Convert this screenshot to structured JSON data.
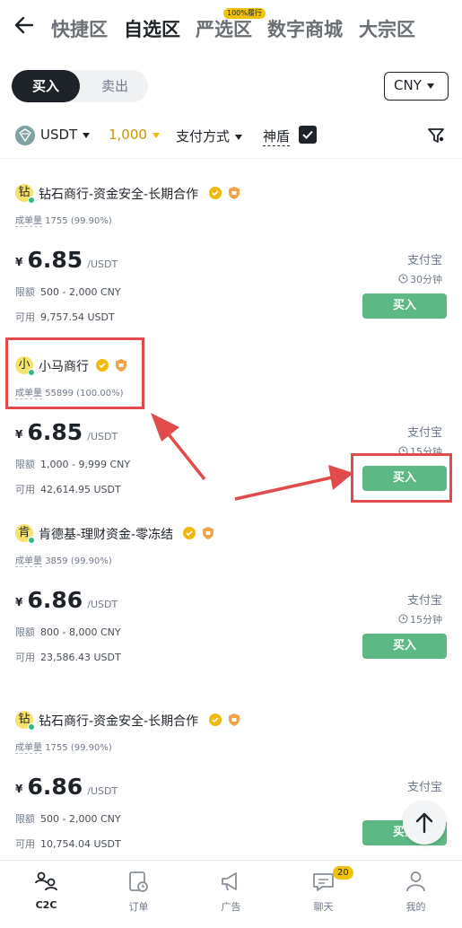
{
  "nav": {
    "tabs": [
      {
        "label": "快捷区"
      },
      {
        "label": "自选区"
      },
      {
        "label": "严选区"
      },
      {
        "label": "数字商城"
      },
      {
        "label": "大宗区"
      }
    ],
    "active_tab": "自选区",
    "badge": "100%履行"
  },
  "trade": {
    "buy_label": "买入",
    "sell_label": "卖出",
    "currency": "CNY"
  },
  "filters": {
    "asset": "USDT",
    "amount": "1,000",
    "payment": "支付方式",
    "shield": "神盾",
    "shield_checked": true
  },
  "listings": [
    {
      "avatar": "钻",
      "merchant": "钻石商行-资金安全-长期合作",
      "orders_label": "成单量",
      "orders": "1755 (99.90%)",
      "currency_symbol": "¥",
      "price": "6.85",
      "unit": "/USDT",
      "limit_label": "限额",
      "limit": "500 - 2,000 CNY",
      "available_label": "可用",
      "available": "9,757.54 USDT",
      "payment": "支付宝",
      "time": "30分钟",
      "action": "买入"
    },
    {
      "avatar": "小",
      "merchant": "小马商行",
      "orders_label": "成单量",
      "orders": "55899 (100.00%)",
      "currency_symbol": "¥",
      "price": "6.85",
      "unit": "/USDT",
      "limit_label": "限额",
      "limit": "1,000 - 9,999 CNY",
      "available_label": "可用",
      "available": "42,614.95 USDT",
      "payment": "支付宝",
      "time": "15分钟",
      "action": "买入"
    },
    {
      "avatar": "肯",
      "merchant": "肯德基-理财资金-零冻结",
      "orders_label": "成单量",
      "orders": "3859 (99.90%)",
      "currency_symbol": "¥",
      "price": "6.86",
      "unit": "/USDT",
      "limit_label": "限额",
      "limit": "800 - 8,000 CNY",
      "available_label": "可用",
      "available": "23,586.43 USDT",
      "payment": "支付宝",
      "time": "15分钟",
      "action": "买入"
    },
    {
      "avatar": "钻",
      "merchant": "钻石商行-资金安全-长期合作",
      "orders_label": "成单量",
      "orders": "1755 (99.90%)",
      "currency_symbol": "¥",
      "price": "6.86",
      "unit": "/USDT",
      "limit_label": "限额",
      "limit": "500 - 2,000 CNY",
      "available_label": "可用",
      "available": "10,754.04 USDT",
      "payment": "支付宝",
      "time": "",
      "action": "买入"
    }
  ],
  "bottom_nav": [
    {
      "label": "C2C",
      "icon": "c2c-icon"
    },
    {
      "label": "订单",
      "icon": "orders-icon"
    },
    {
      "label": "广告",
      "icon": "megaphone-icon"
    },
    {
      "label": "聊天",
      "icon": "chat-icon",
      "badge": "20"
    },
    {
      "label": "我的",
      "icon": "profile-icon"
    }
  ],
  "colors": {
    "buy_green": "#5cb884",
    "accent_gold": "#f0b90b",
    "annotation_red": "#e24b4b"
  }
}
